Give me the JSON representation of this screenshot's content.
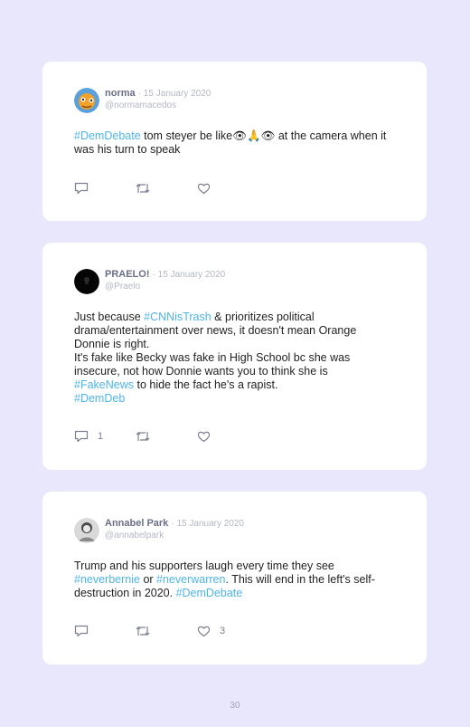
{
  "tweets": [
    {
      "name": "norma",
      "date": "15 January 2020",
      "handle": "@normamacedos",
      "body": [
        {
          "t": "tag",
          "v": "#DemDebate"
        },
        {
          "t": "text",
          "v": " tom steyer be like👁🙏👁 at the camera when it was his turn to speak"
        }
      ],
      "reply_count": "",
      "retweet_count": "",
      "like_count": ""
    },
    {
      "name": "PRAELO!",
      "date": "15 January 2020",
      "handle": "@Praelo",
      "body": [
        {
          "t": "text",
          "v": "Just because "
        },
        {
          "t": "tag",
          "v": "#CNNisTrash"
        },
        {
          "t": "text",
          "v": " & prioritizes political drama/entertainment over news, it doesn't mean Orange Donnie is right."
        },
        {
          "t": "br"
        },
        {
          "t": "text",
          "v": "It's fake like Becky was fake in High School bc she was insecure, not how Donnie wants you to think she is "
        },
        {
          "t": "tag",
          "v": "#FakeNews"
        },
        {
          "t": "text",
          "v": " to hide the fact he's a rapist."
        },
        {
          "t": "br"
        },
        {
          "t": "tag",
          "v": "#DemDeb"
        }
      ],
      "reply_count": "1",
      "retweet_count": "",
      "like_count": ""
    },
    {
      "name": "Annabel Park",
      "date": "15 January 2020",
      "handle": "@annabelpark",
      "body": [
        {
          "t": "text",
          "v": "Trump and his supporters laugh every time they see "
        },
        {
          "t": "tag",
          "v": "#neverbernie"
        },
        {
          "t": "text",
          "v": " or "
        },
        {
          "t": "tag",
          "v": "#neverwarren"
        },
        {
          "t": "text",
          "v": ". This will end in the left's self-destruction in 2020. "
        },
        {
          "t": "tag",
          "v": "#DemDebate"
        }
      ],
      "reply_count": "",
      "retweet_count": "",
      "like_count": "3"
    }
  ],
  "page_number": "30",
  "colors": {
    "background": "#e9e7fb",
    "card": "#ffffff",
    "hashtag": "#4fb4e9",
    "name": "#6a6f86",
    "meta": "#b4b7c4"
  },
  "icons": [
    "reply-icon",
    "retweet-icon",
    "like-icon"
  ]
}
